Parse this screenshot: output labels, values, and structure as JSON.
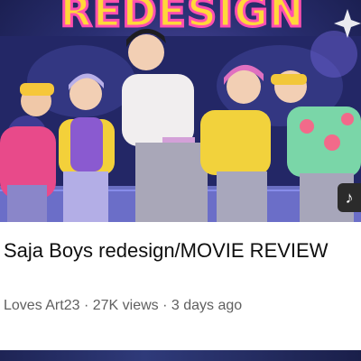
{
  "video": {
    "thumbnail_text": "REDESIGN",
    "title": "Saja Boys redesign/MOVIE REVIEW",
    "channel": "Loves Art23",
    "views": "27K views",
    "age": "3 days ago",
    "separator": "·"
  },
  "icons": {
    "music": "music-note-icon",
    "sparkle": "sparkle-icon"
  },
  "colors": {
    "title_text": "#0f0f0f",
    "meta_text": "#606060",
    "thumb_title_fill": "#ffd83a",
    "thumb_title_stroke": "#ff4fb0"
  }
}
